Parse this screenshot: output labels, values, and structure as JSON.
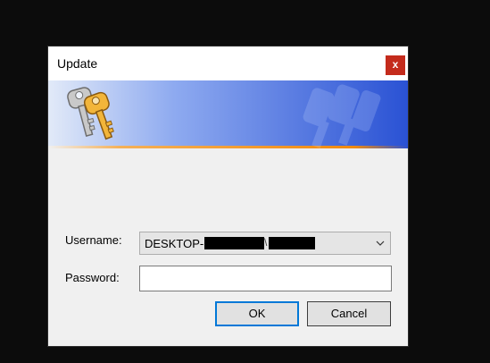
{
  "dialog": {
    "title": "Update",
    "close_label": "x",
    "close_icon": "close-icon",
    "banner_icon": "keys-icon",
    "colors": {
      "banner_start": "#dce6f7",
      "banner_end": "#2a55d6",
      "accent_line": "#f0a030",
      "button_focus": "#0078d7",
      "close": "#c42b1c"
    }
  },
  "form": {
    "username_label": "Username:",
    "username_value": "DESKTOP-",
    "password_label": "Password:",
    "password_value": "",
    "ok_label": "OK",
    "cancel_label": "Cancel"
  }
}
